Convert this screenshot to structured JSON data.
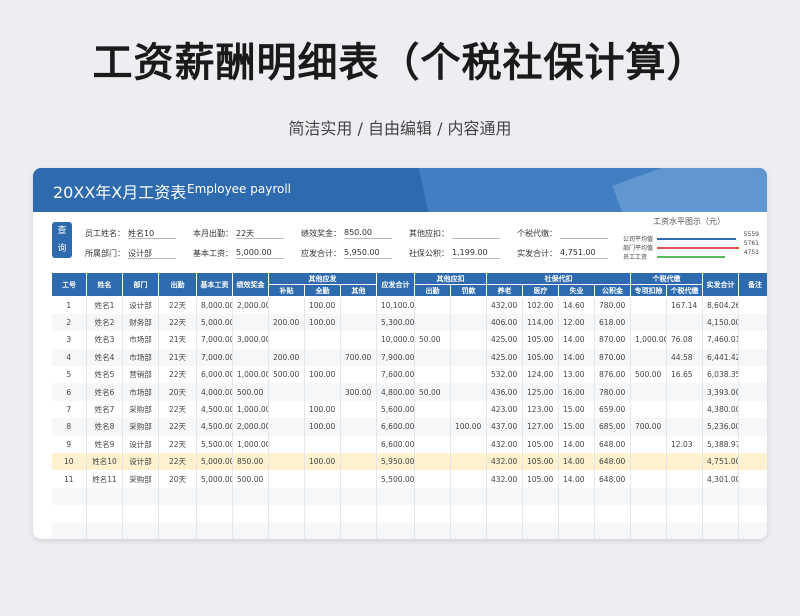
{
  "hero": {
    "title": "工资薪酬明细表（个税社保计算）",
    "subtitle": "简洁实用 / 自由编辑 / 内容通用"
  },
  "banner": {
    "title": "20XX年X月工资表",
    "subtitle": "Employee payroll"
  },
  "query_button": "查 询",
  "info": {
    "row1": [
      {
        "label": "员工姓名：",
        "value": "姓名10"
      },
      {
        "label": "本月出勤：",
        "value": "22天"
      },
      {
        "label": "绩效奖金：",
        "value": "850.00"
      },
      {
        "label": "其他应扣：",
        "value": ""
      },
      {
        "label": "个税代缴：",
        "value": ""
      }
    ],
    "row2": [
      {
        "label": "所属部门：",
        "value": "设计部"
      },
      {
        "label": "基本工资：",
        "value": "5,000.00"
      },
      {
        "label": "应发合计：",
        "value": "5,950.00"
      },
      {
        "label": "社保公积：",
        "value": "1,199.00"
      },
      {
        "label": "实发合计：",
        "value": "4,751.00"
      }
    ]
  },
  "mini_chart": {
    "title": "工资水平图示（元）",
    "rows": [
      {
        "label": "公司平均值",
        "value": "5559",
        "color": "#2e6aae"
      },
      {
        "label": "部门平均值",
        "value": "5761",
        "color": "#d9534f"
      },
      {
        "label": "员工工资",
        "value": "4751",
        "color": "#5cb85c"
      }
    ]
  },
  "table": {
    "headers_top": [
      "工号",
      "姓名",
      "部门",
      "出勤",
      "基本工资",
      "绩效奖金",
      "其他应发",
      "应发合计",
      "其他应扣",
      "社保代扣",
      "个税代缴",
      "实发合计",
      "备注"
    ],
    "headers_sub": [
      "补贴",
      "全勤",
      "其他",
      "出勤",
      "罚款",
      "养老",
      "医疗",
      "失业",
      "公积金",
      "专项扣除",
      "个税代缴"
    ],
    "rows": [
      [
        "1",
        "姓名1",
        "设计部",
        "22天",
        "8,000.00",
        "2,000.00",
        "",
        "100.00",
        "",
        "10,100.00",
        "",
        "",
        "432.00",
        "102.00",
        "14.60",
        "780.00",
        "",
        "167.14",
        "8,604.26",
        ""
      ],
      [
        "2",
        "姓名2",
        "财务部",
        "22天",
        "5,000.00",
        "",
        "200.00",
        "100.00",
        "",
        "5,300.00",
        "",
        "",
        "406.00",
        "114.00",
        "12.00",
        "618.00",
        "",
        "",
        "4,150.00",
        ""
      ],
      [
        "3",
        "姓名3",
        "市场部",
        "21天",
        "7,000.00",
        "3,000.00",
        "",
        "",
        "",
        "10,000.00",
        "50.00",
        "",
        "425.00",
        "105.00",
        "14.00",
        "870.00",
        "1,000.00",
        "76.08",
        "7,460.01",
        ""
      ],
      [
        "4",
        "姓名4",
        "市场部",
        "21天",
        "7,000.00",
        "",
        "200.00",
        "",
        "700.00",
        "7,900.00",
        "",
        "",
        "425.00",
        "105.00",
        "14.00",
        "870.00",
        "",
        "44.58",
        "6,441.42",
        ""
      ],
      [
        "5",
        "姓名5",
        "营销部",
        "22天",
        "6,000.00",
        "1,000.00",
        "500.00",
        "100.00",
        "",
        "7,600.00",
        "",
        "",
        "532.00",
        "124.00",
        "13.00",
        "876.00",
        "500.00",
        "16.65",
        "6,038.35",
        ""
      ],
      [
        "6",
        "姓名6",
        "市场部",
        "20天",
        "4,000.00",
        "500.00",
        "",
        "",
        "300.00",
        "4,800.00",
        "50.00",
        "",
        "436.00",
        "125.00",
        "16.00",
        "780.00",
        "",
        "",
        "3,393.00",
        ""
      ],
      [
        "7",
        "姓名7",
        "采购部",
        "22天",
        "4,500.00",
        "1,000.00",
        "",
        "100.00",
        "",
        "5,600.00",
        "",
        "",
        "423.00",
        "123.00",
        "15.00",
        "659.00",
        "",
        "",
        "4,380.00",
        ""
      ],
      [
        "8",
        "姓名8",
        "采购部",
        "22天",
        "4,500.00",
        "2,000.00",
        "",
        "100.00",
        "",
        "6,600.00",
        "",
        "100.00",
        "437.00",
        "127.00",
        "15.00",
        "685.00",
        "700.00",
        "",
        "5,236.00",
        ""
      ],
      [
        "9",
        "姓名9",
        "设计部",
        "22天",
        "5,500.00",
        "1,000.00",
        "",
        "",
        "",
        "6,600.00",
        "",
        "",
        "432.00",
        "105.00",
        "14.00",
        "648.00",
        "",
        "12.03",
        "5,388.97",
        ""
      ],
      [
        "10",
        "姓名10",
        "设计部",
        "22天",
        "5,000.00",
        "850.00",
        "",
        "100.00",
        "",
        "5,950.00",
        "",
        "",
        "432.00",
        "105.00",
        "14.00",
        "648.00",
        "",
        "",
        "4,751.00",
        ""
      ],
      [
        "11",
        "姓名11",
        "采购部",
        "20天",
        "5,000.00",
        "500.00",
        "",
        "",
        "",
        "5,500.00",
        "",
        "",
        "432.00",
        "105.00",
        "14.00",
        "648.00",
        "",
        "",
        "4,301.00",
        ""
      ]
    ]
  }
}
